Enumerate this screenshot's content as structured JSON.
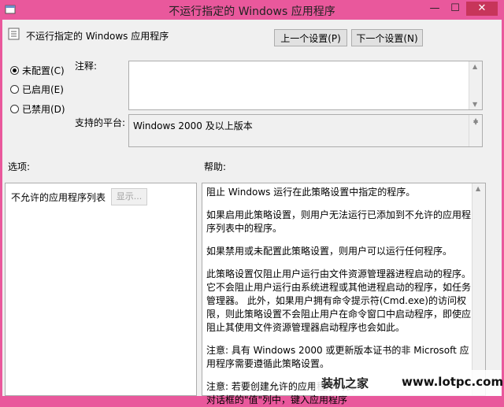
{
  "window": {
    "title": "不运行指定的 Windows 应用程序",
    "min_glyph": "—",
    "max_glyph": "☐",
    "close_glyph": "✕"
  },
  "header": {
    "policy_title": "不运行指定的 Windows 应用程序",
    "prev_button": "上一个设置(P)",
    "next_button": "下一个设置(N)"
  },
  "state": {
    "options": [
      {
        "label": "未配置(C)",
        "selected": true
      },
      {
        "label": "已启用(E)",
        "selected": false
      },
      {
        "label": "已禁用(D)",
        "selected": false
      }
    ]
  },
  "fields": {
    "comment_label": "注释:",
    "comment_value": "",
    "platform_label": "支持的平台:",
    "platform_value": "Windows 2000 及以上版本"
  },
  "options_panel": {
    "header": "选项:",
    "list_label": "不允许的应用程序列表",
    "show_button": "显示..."
  },
  "help_panel": {
    "header": "帮助:",
    "paragraphs": [
      "阻止 Windows 运行在此策略设置中指定的程序。",
      "如果启用此策略设置，则用户无法运行已添加到不允许的应用程序列表中的程序。",
      "如果禁用或未配置此策略设置，则用户可以运行任何程序。",
      "此策略设置仅阻止用户运行由文件资源管理器进程启动的程序。它不会阻止用户运行由系统进程或其他进程启动的程序，如任务管理器。 此外，如果用户拥有命令提示符(Cmd.exe)的访问权限，则此策略设置不会阻止用户在命令窗口中启动程序，即使应阻止其使用文件资源管理器启动程序也会如此。",
      "注意: 具有 Windows 2000 或更新版本证书的非 Microsoft 应用程序需要遵循此策略设置。",
      "注意: 若要创建允许的应用程序列表",
      "对话框的\"值\"列中，键入应用程序"
    ]
  },
  "watermark": {
    "brand": "装机之家",
    "url": "www.lotpc.com"
  }
}
